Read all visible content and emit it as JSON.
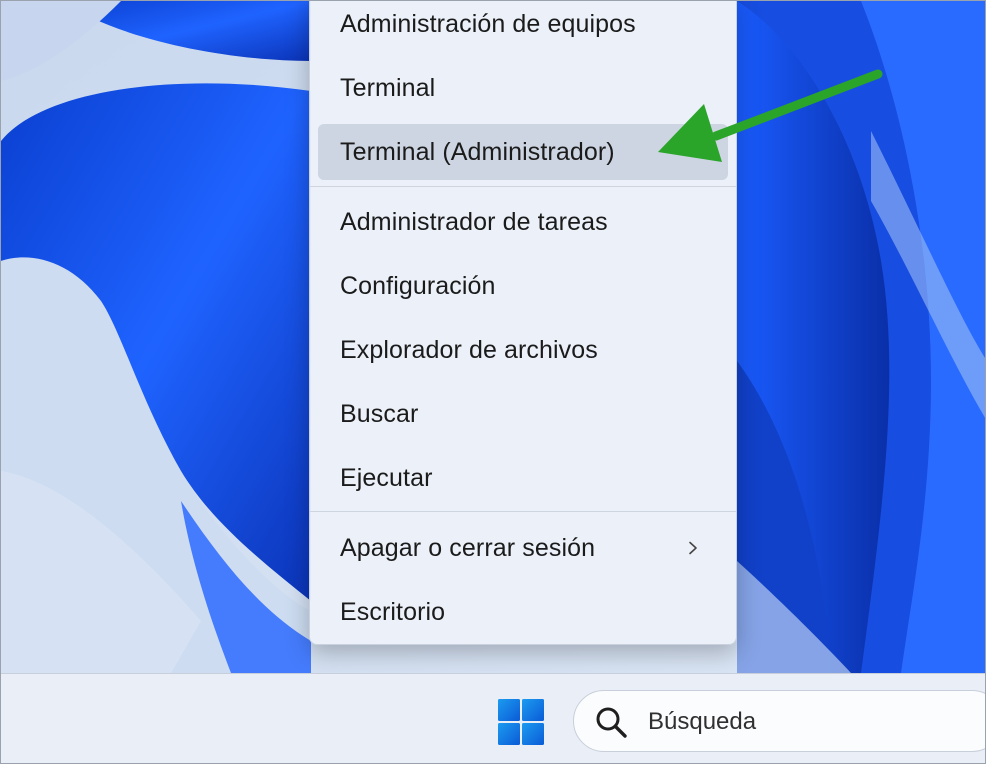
{
  "menu": {
    "items": [
      {
        "label": "Administración de equipos"
      },
      {
        "label": "Terminal"
      },
      {
        "label": "Terminal (Administrador)"
      },
      {
        "label": "Administrador de tareas"
      },
      {
        "label": "Configuración"
      },
      {
        "label": "Explorador de archivos"
      },
      {
        "label": "Buscar"
      },
      {
        "label": "Ejecutar"
      },
      {
        "label": "Apagar o cerrar sesión"
      },
      {
        "label": "Escritorio"
      }
    ],
    "highlighted": "Terminal (Administrador)",
    "submenu_icon": "chevron-right-icon"
  },
  "annotation": {
    "arrow_color": "#2aa52a"
  },
  "taskbar": {
    "start_icon": "windows-logo-icon",
    "search": {
      "placeholder": "Búsqueda",
      "icon": "search-icon"
    }
  },
  "colors": {
    "accent": "#0a5bd6",
    "wallpaper": "#1a55e8"
  }
}
